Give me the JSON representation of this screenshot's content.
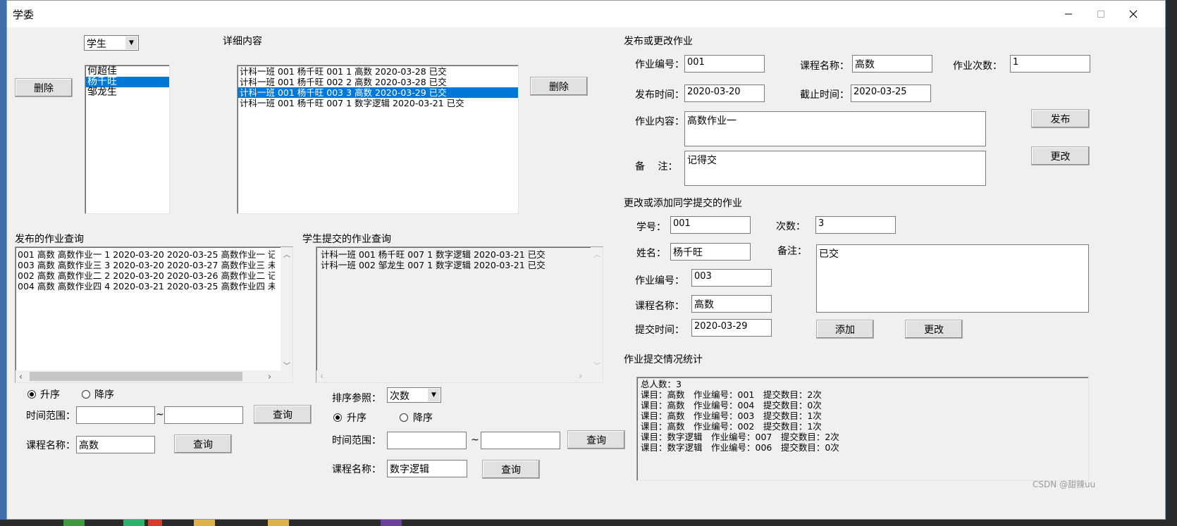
{
  "window": {
    "title": "学委"
  },
  "student_panel": {
    "type_select": "学生",
    "delete_label": "删除",
    "students": [
      "何超佳",
      "杨千旺",
      "邹龙生"
    ],
    "selected_index": 1
  },
  "detail": {
    "header": "详细内容",
    "rows": [
      "计科一班 001 杨千旺 001 1 高数 2020-03-28 已交",
      "计科一班 001 杨千旺 002 2 高数 2020-03-28 已交",
      "计科一班 001 杨千旺 003 3 高数 2020-03-29 已交",
      "计科一班 001 杨千旺 007 1 数字逻辑 2020-03-21 已交"
    ],
    "selected_index": 2,
    "delete_label": "删除"
  },
  "publish": {
    "header": "发布或更改作业",
    "hw_no_label": "作业编号：",
    "hw_no": "001",
    "course_label": "课程名称：",
    "course": "高数",
    "times_label": "作业次数：",
    "times": "1",
    "publish_time_label": "发布时间：",
    "publish_time": "2020-03-20",
    "deadline_label": "截止时间：",
    "deadline": "2020-03-25",
    "content_label": "作业内容：",
    "content": "高数作业一",
    "remark_label": "备　 注：",
    "remark": "记得交",
    "publish_btn": "发布",
    "modify_btn": "更改"
  },
  "submission_edit": {
    "header": "更改或添加同学提交的作业",
    "id_label": "学号：",
    "id": "001",
    "count_label": "次数：",
    "count": "3",
    "name_label": "姓名：",
    "name": "杨千旺",
    "remark_label": "备注：",
    "remark": "已交",
    "hw_no_label": "作业编号：",
    "hw_no": "003",
    "course_label": "课程名称：",
    "course": "高数",
    "submit_time_label": "提交时间：",
    "submit_time": "2020-03-29",
    "add_btn": "添加",
    "modify_btn": "更改"
  },
  "published_query": {
    "header": "发布的作业查询",
    "rows": [
      "001 高数 高数作业一 1 2020-03-20 2020-03-25 高数作业一 记得",
      "003 高数 高数作业三 3 2020-03-20 2020-03-27 高数作业三 未交",
      "002 高数 高数作业二 2 2020-03-20 2020-03-26 高数作业二 记得",
      "004 高数 高数作业四 4 2020-03-21 2020-03-25 高数作业四 未交"
    ],
    "asc_label": "升序",
    "desc_label": "降序",
    "range_label": "时间范围：",
    "tilde": "~",
    "query_btn": "查询",
    "course_label": "课程名称：",
    "course": "高数",
    "query_btn2": "查询"
  },
  "student_query": {
    "header": "学生提交的作业查询",
    "rows": [
      "计科一班 001 杨千旺 007 1 数字逻辑 2020-03-21 已交",
      "计科一班 002 邹龙生 007 1 数字逻辑 2020-03-21 已交"
    ],
    "sort_label": "排序参照：",
    "sort_value": "次数",
    "asc_label": "升序",
    "desc_label": "降序",
    "range_label": "时间范围：",
    "tilde": "~",
    "query_btn": "查询",
    "course_label": "课程名称：",
    "course": "数字逻辑",
    "query_btn2": "查询"
  },
  "stats": {
    "header": "作业提交情况统计",
    "lines": [
      "总人数：3",
      "课目：高数　作业编号：001　提交数目：2次",
      "课目：高数　作业编号：004　提交数目：0次",
      "课目：高数　作业编号：003　提交数目：1次",
      "课目：高数　作业编号：002　提交数目：1次",
      "课目：数字逻辑　作业编号：007　提交数目：2次",
      "课目：数字逻辑　作业编号：006　提交数目：0次"
    ]
  },
  "watermark": "CSDN @甜辣uu"
}
